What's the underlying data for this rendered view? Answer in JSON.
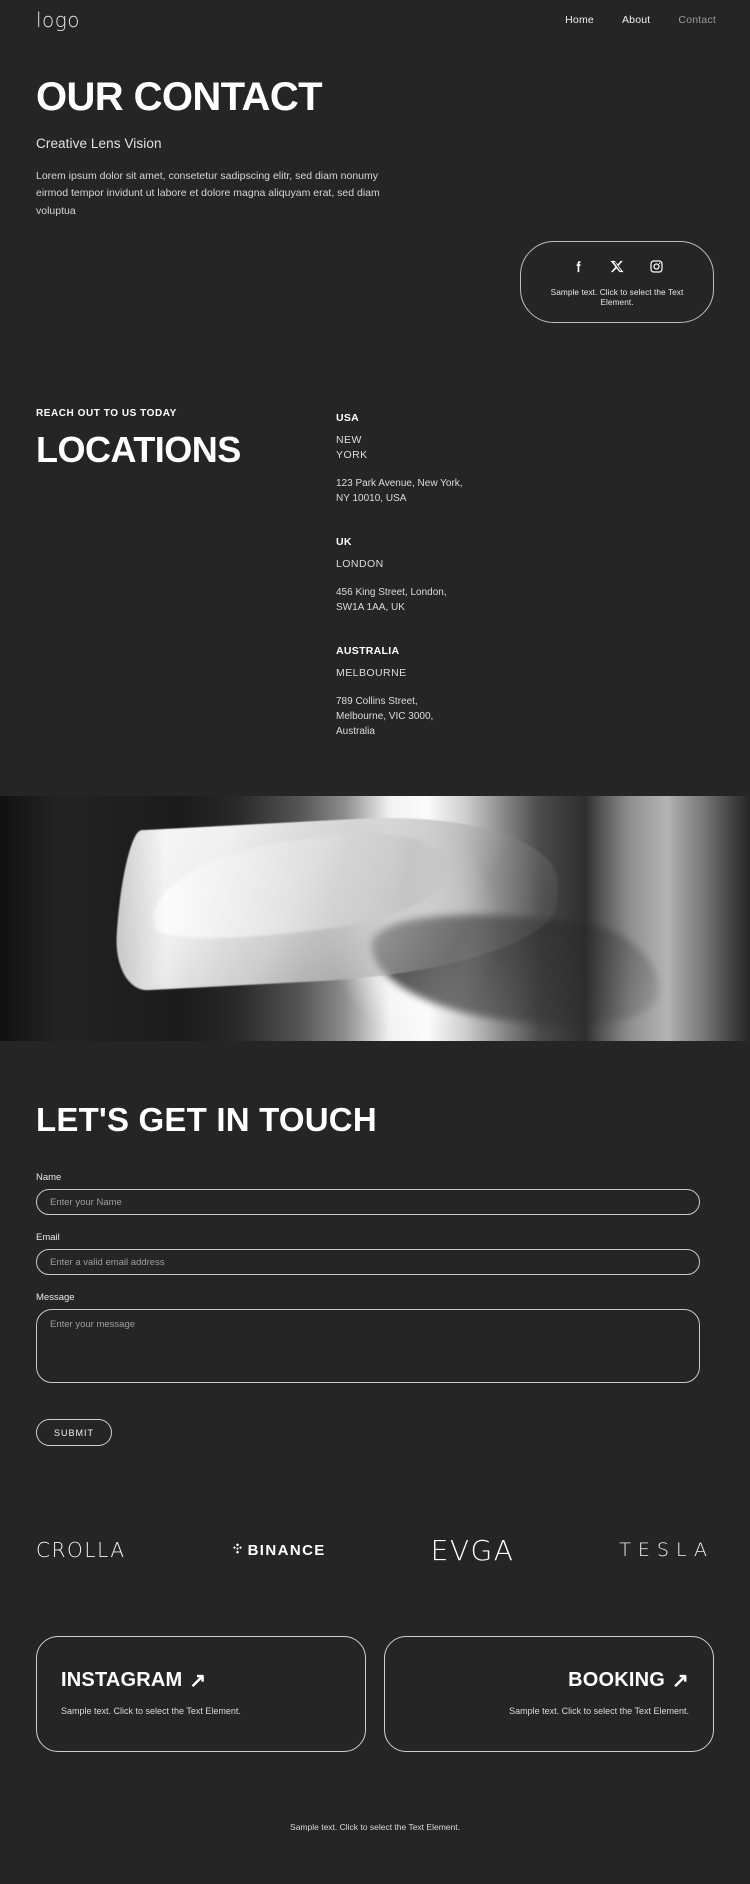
{
  "nav": {
    "logo": "logo",
    "links": [
      {
        "label": "Home",
        "muted": false
      },
      {
        "label": "About",
        "muted": false
      },
      {
        "label": "Contact",
        "muted": true
      }
    ]
  },
  "hero": {
    "title": "OUR CONTACT",
    "subtitle": "Creative Lens Vision",
    "paragraph": "Lorem ipsum dolor sit amet, consetetur sadipscing elitr, sed diam nonumy eirmod tempor invidunt ut labore et dolore magna aliquyam erat, sed diam voluptua"
  },
  "social_card": {
    "icons": [
      "facebook-icon",
      "x-twitter-icon",
      "instagram-icon"
    ],
    "note": "Sample text. Click to select the Text Element."
  },
  "locations": {
    "eyebrow": "REACH OUT TO US TODAY",
    "title": "LOCATIONS",
    "items": [
      {
        "country": "USA",
        "city": "NEW\nYORK",
        "address": "123 Park Avenue, New York,\nNY 10010, USA"
      },
      {
        "country": "UK",
        "city": "LONDON",
        "address": "456 King Street, London,\nSW1A 1AA, UK"
      },
      {
        "country": "AUSTRALIA",
        "city": "MELBOURNE",
        "address": "789 Collins Street,\nMelbourne, VIC 3000,\nAustralia"
      }
    ]
  },
  "hero_image": {
    "alt": "abstract-white-fabric-photo"
  },
  "contact_form": {
    "title": "LET'S GET IN TOUCH",
    "fields": [
      {
        "label": "Name",
        "placeholder": "Enter your Name",
        "value": ""
      },
      {
        "label": "Email",
        "placeholder": "Enter a valid email address",
        "value": ""
      },
      {
        "label": "Message",
        "placeholder": "Enter your message",
        "value": ""
      }
    ],
    "submit_label": "SUBMIT"
  },
  "brands": [
    {
      "name": "CROLLA"
    },
    {
      "name": "BINANCE"
    },
    {
      "name": "EVGA"
    },
    {
      "name": "TESLA"
    }
  ],
  "cta_cards": [
    {
      "title": "INSTAGRAM",
      "arrow": "↗",
      "note": "Sample text. Click to select the Text Element."
    },
    {
      "title": "BOOKING",
      "arrow": "↗",
      "note": "Sample text. Click to select the Text Element."
    }
  ],
  "footer": {
    "note": "Sample text. Click to select the Text Element."
  },
  "colors": {
    "background": "#252525",
    "text": "#ffffff",
    "muted": "#9a9a9a",
    "border": "#cfcfcf"
  }
}
